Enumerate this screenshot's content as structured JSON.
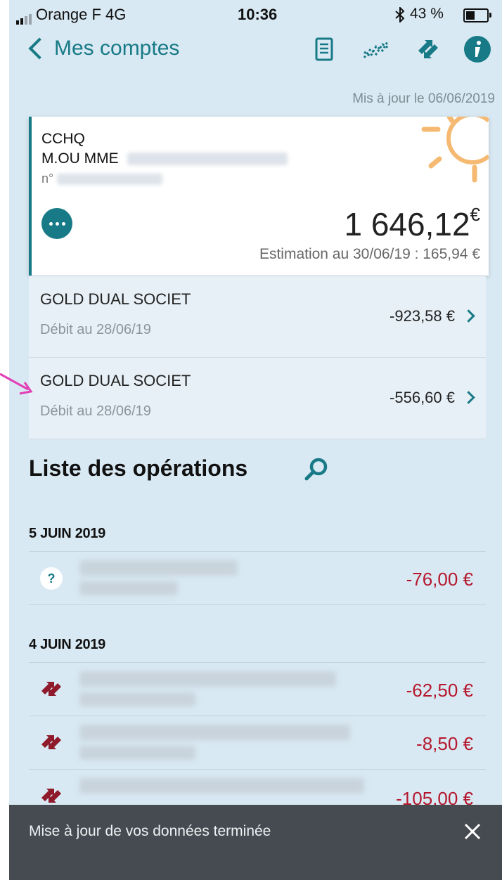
{
  "status": {
    "carrier": "Orange F  4G",
    "time": "10:36",
    "battery": "43 %"
  },
  "nav": {
    "back_label": "Mes comptes"
  },
  "updated": "Mis à jour le 06/06/2019",
  "account": {
    "type": "CCHQ",
    "holder_prefix": "M.OU MME",
    "number_prefix": "n°",
    "balance": "1 646,12",
    "currency": "€",
    "estimate": "Estimation au 30/06/19 : 165,94 €"
  },
  "cards": [
    {
      "name": "GOLD DUAL SOCIET",
      "date": "Débit au 28/06/19",
      "amount": "-923,58 €"
    },
    {
      "name": "GOLD DUAL SOCIET",
      "date": "Débit au 28/06/19",
      "amount": "-556,60 €"
    }
  ],
  "operations": {
    "title": "Liste des opérations",
    "days": [
      {
        "date": "5 JUIN 2019",
        "items": [
          {
            "icon": "question-icon",
            "icon_text": "?",
            "amount": "-76,00 €"
          }
        ]
      },
      {
        "date": "4 JUIN 2019",
        "items": [
          {
            "icon": "transfer-icon",
            "amount": "-62,50 €"
          },
          {
            "icon": "transfer-icon",
            "amount": "-8,50 €"
          },
          {
            "icon": "transfer-icon",
            "amount": "-105,00 €"
          }
        ]
      }
    ]
  },
  "toast": {
    "message": "Mise à jour de vos données terminée"
  },
  "colors": {
    "accent": "#177a86",
    "background": "#d9e9f3",
    "negative": "#b5182e",
    "sun": "#f5b971",
    "icon_red": "#8e1a2b"
  }
}
